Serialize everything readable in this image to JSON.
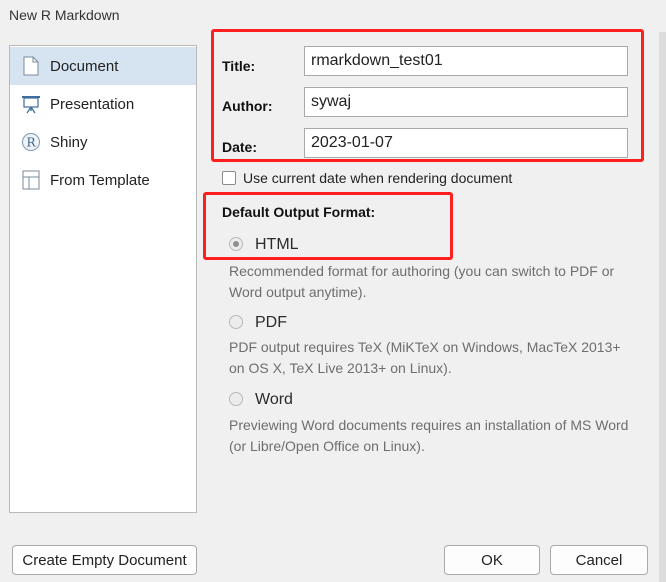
{
  "window": {
    "title": "New R Markdown"
  },
  "sidebar": {
    "items": [
      {
        "label": "Document",
        "icon": "document-icon",
        "selected": true
      },
      {
        "label": "Presentation",
        "icon": "presentation-icon",
        "selected": false
      },
      {
        "label": "Shiny",
        "icon": "shiny-r-icon",
        "selected": false
      },
      {
        "label": "From Template",
        "icon": "template-icon",
        "selected": false
      }
    ]
  },
  "form": {
    "title_label": "Title:",
    "title_value": "rmarkdown_test01",
    "author_label": "Author:",
    "author_value": "sywaj",
    "date_label": "Date:",
    "date_value": "2023-01-07",
    "use_current_date_label": "Use current date when rendering document",
    "use_current_date_checked": false
  },
  "output_format": {
    "heading": "Default Output Format:",
    "options": [
      {
        "label": "HTML",
        "checked": true,
        "description": "Recommended format for authoring (you can switch to PDF or Word output anytime)."
      },
      {
        "label": "PDF",
        "checked": false,
        "description": "PDF output requires TeX (MiKTeX on Windows, MacTeX 2013+ on OS X, TeX Live 2013+ on Linux)."
      },
      {
        "label": "Word",
        "checked": false,
        "description": "Previewing Word documents requires an installation of MS Word (or Libre/Open Office on Linux)."
      }
    ]
  },
  "buttons": {
    "create_empty": "Create Empty Document",
    "ok": "OK",
    "cancel": "Cancel"
  },
  "colors": {
    "highlight_box": "#ff1f1f",
    "selected_item_bg": "#d6e4f1"
  }
}
